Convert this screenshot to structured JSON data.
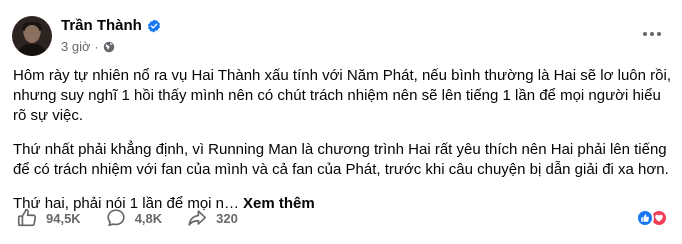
{
  "post": {
    "author": "Trần Thành",
    "time": "3 giờ",
    "separator": "·",
    "paragraphs": [
      "Hôm rày tự nhiên nổ ra vụ Hai Thành xấu tính với Năm Phát, nếu bình thường là Hai sẽ lơ luôn rồi, nhưng suy nghĩ 1 hồi thấy mình nên có chút trách nhiệm nên sẽ lên tiếng 1 lần để mọi người hiểu rõ sự việc.",
      "Thứ nhất phải khẳng định, vì Running Man là chương trình Hai rất yêu thích nên Hai phải lên tiếng để có trách nhiệm với fan của mình và cả fan của Phát, trước khi câu chuyện bị dẫn giải đi xa hơn."
    ],
    "truncated_line": "Thứ hai, phải nói 1 lần để mọi n…",
    "see_more": "Xem thêm"
  },
  "actions": {
    "likes": "94,5K",
    "comments": "4,8K",
    "shares": "320"
  },
  "icons": {
    "verified": "verified-badge-icon",
    "audience": "globe-icon",
    "more": "more-options-icon",
    "like": "thumbs-up-icon",
    "comment": "comment-bubble-icon",
    "share": "share-arrow-icon",
    "reaction_like": "like-reaction-icon",
    "reaction_love": "love-reaction-icon"
  },
  "colors": {
    "brand_blue": "#1877f2",
    "love_red": "#f33e58",
    "secondary_text": "#65676b",
    "primary_text": "#050505"
  }
}
